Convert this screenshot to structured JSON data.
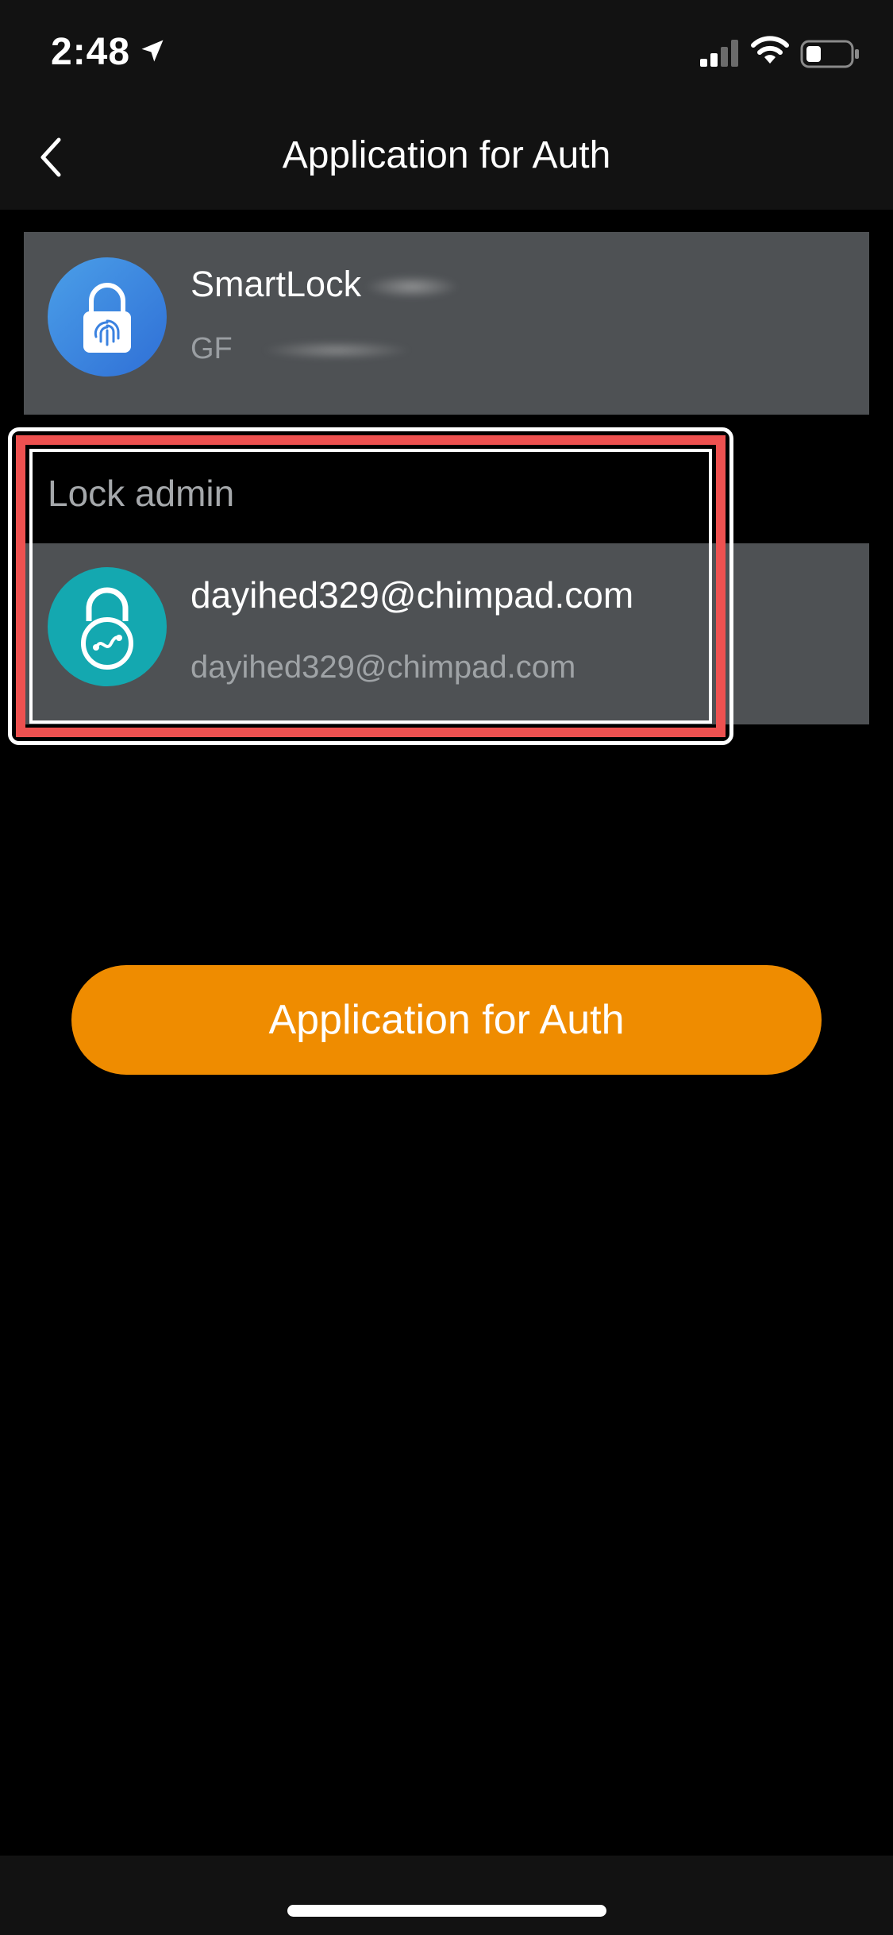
{
  "status_bar": {
    "time": "2:48",
    "icons": [
      "location-arrow-icon",
      "cellular-signal-icon",
      "wifi-icon",
      "battery-icon"
    ]
  },
  "nav": {
    "title": "Application for Auth",
    "back_icon": "chevron-left-icon"
  },
  "device": {
    "name": "SmartLock",
    "id_prefix": "GF",
    "icon": "fingerprint-lock-icon"
  },
  "admin_section": {
    "label": "Lock admin",
    "user_name": "dayihed329@chimpad.com",
    "user_email": "dayihed329@chimpad.com",
    "icon": "padlock-icon"
  },
  "actions": {
    "auth_button_label": "Application for Auth"
  },
  "colors": {
    "accent": "#ef8c00",
    "highlight": "#ee5150",
    "card_bg": "#4e5154",
    "device_icon_bg": "#3b82e0",
    "admin_icon_bg": "#14a8b0"
  }
}
